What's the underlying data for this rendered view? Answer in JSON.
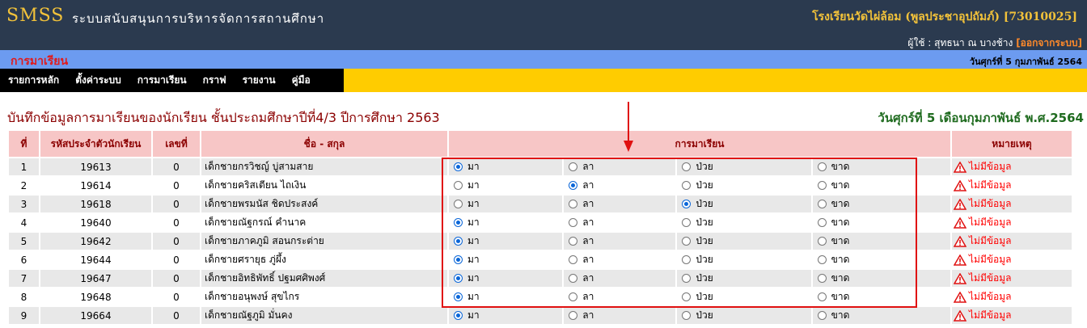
{
  "header": {
    "brand": "SMSS",
    "subtitle": "ระบบสนับสนุนการบริหารจัดการสถานศึกษา",
    "school": "โรงเรียนวัดไผ่ล้อม (พูลประชาอุปถัมภ์) [73010025]",
    "user_prefix": "ผู้ใช้ : สุทธนา ณ บางช้าง",
    "logout": "[ออกจากระบบ]"
  },
  "section_bar": {
    "title": "การมาเรียน",
    "date": "วันศุกร์ที่ 5 กุมภาพันธ์ 2564"
  },
  "nav": [
    "รายการหลัก",
    "ตั้งค่าระบบ",
    "การมาเรียน",
    "กราฟ",
    "รายงาน",
    "คู่มือ"
  ],
  "page": {
    "title": "บันทึกข้อมูลการมาเรียนของนักเรียน ชั้นประถมศึกษาปีที่4/3 ปีการศึกษา 2563",
    "date": "วันศุกร์ที่ 5 เดือนกุมภาพันธ์ พ.ศ.2564"
  },
  "table": {
    "headers": {
      "no": "ที่",
      "student_id": "รหัสประจำตัวนักเรียน",
      "number": "เลขที่",
      "name": "ชื่อ - สกุล",
      "attendance": "การมาเรียน",
      "remark": "หมายเหตุ"
    },
    "options": [
      "มา",
      "ลา",
      "ป่วย",
      "ขาด"
    ],
    "remark_text": "ไม่มีข้อมูล",
    "rows": [
      {
        "no": "1",
        "id": "19613",
        "num": "0",
        "name": "เด็กชายกรวิชญ์ บู่สามสาย",
        "status": 0
      },
      {
        "no": "2",
        "id": "19614",
        "num": "0",
        "name": "เด็กชายคริสเตียน ไถเงิน",
        "status": 1
      },
      {
        "no": "3",
        "id": "19618",
        "num": "0",
        "name": "เด็กชายพรมนัส ชิดประสงค์",
        "status": 2
      },
      {
        "no": "4",
        "id": "19640",
        "num": "0",
        "name": "เด็กชายณัฐกรณ์ คำนาค",
        "status": 0
      },
      {
        "no": "5",
        "id": "19642",
        "num": "0",
        "name": "เด็กชายภาคภูมิ สอนกระต่าย",
        "status": 0
      },
      {
        "no": "6",
        "id": "19644",
        "num": "0",
        "name": "เด็กชายศรายุธ ภู่ผึ้ง",
        "status": 0
      },
      {
        "no": "7",
        "id": "19647",
        "num": "0",
        "name": "เด็กชายอิทธิพัทธิ์ ปฐมศศิพงศ์",
        "status": 0
      },
      {
        "no": "8",
        "id": "19648",
        "num": "0",
        "name": "เด็กชายอนุพงษ์ สุขไกร",
        "status": 0
      },
      {
        "no": "9",
        "id": "19664",
        "num": "0",
        "name": "เด็กชายณัฐภูมิ มั่นคง",
        "status": 0
      }
    ]
  },
  "colors": {
    "topbar": "#2b3a4f",
    "brand": "#f2c23a",
    "section_bar": "#6c9bf0",
    "nav_strip": "#ffcc00",
    "header_cell": "#f7c6c6",
    "highlight_box": "#e01010"
  }
}
